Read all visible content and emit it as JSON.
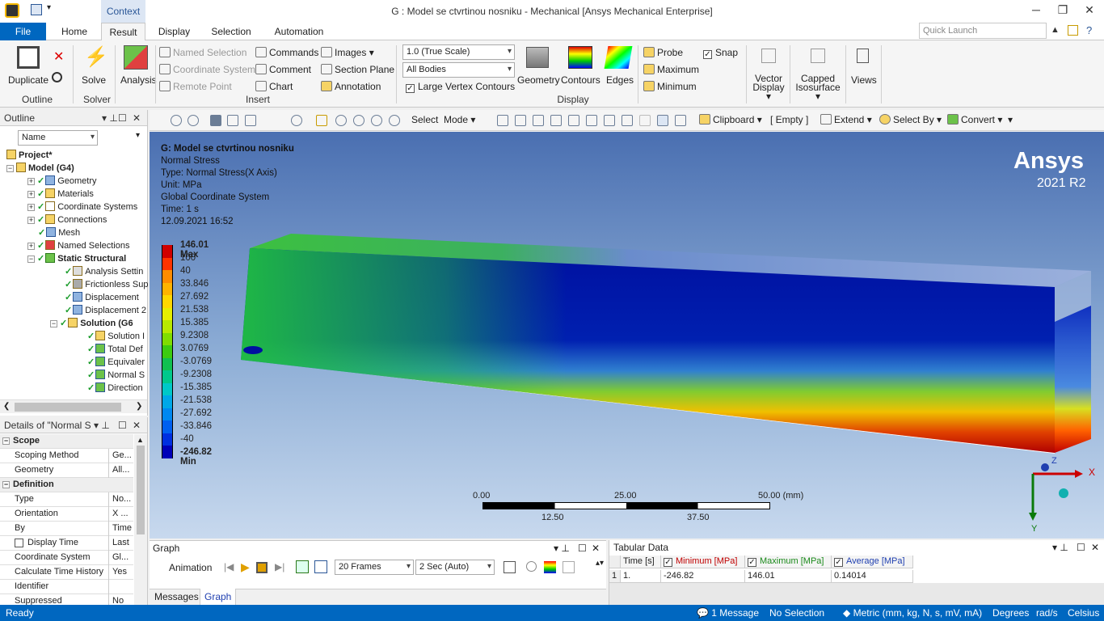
{
  "titlebar": {
    "title": "G : Model se ctvrtinou nosniku - Mechanical [Ansys Mechanical Enterprise]",
    "context_tab": "Context",
    "quick_launch_placeholder": "Quick Launch"
  },
  "tabs": [
    "File",
    "Home",
    "Result",
    "Display",
    "Selection",
    "Automation"
  ],
  "ribbon": {
    "duplicate": "Duplicate",
    "outline_group": "Outline",
    "solve": "Solve",
    "solver_group": "Solver",
    "analysis": "Analysis",
    "named_selection": "Named Selection",
    "coordinate_system": "Coordinate System",
    "remote_point": "Remote Point",
    "commands": "Commands",
    "comment": "Comment",
    "chart": "Chart",
    "images": "Images",
    "section_plane": "Section Plane",
    "annotation": "Annotation",
    "insert_group": "Insert",
    "scale": "1.0 (True Scale)",
    "bodies": "All Bodies",
    "large_vertex": "Large Vertex Contours",
    "geometry": "Geometry",
    "contours": "Contours",
    "edges": "Edges",
    "display_group": "Display",
    "probe": "Probe",
    "maximum": "Maximum",
    "minimum": "Minimum",
    "snap": "Snap",
    "vector_display": "Vector Display",
    "capped_isosurface": "Capped Isosurface",
    "views": "Views"
  },
  "toolbar": {
    "select": "Select",
    "mode": "Mode",
    "clipboard": "Clipboard",
    "empty": "[ Empty ]",
    "extend": "Extend",
    "select_by": "Select By",
    "convert": "Convert"
  },
  "outline": {
    "title": "Outline",
    "filter": "Name",
    "items": [
      "Project*",
      "Model (G4)",
      "Geometry",
      "Materials",
      "Coordinate Systems",
      "Connections",
      "Mesh",
      "Named Selections",
      "Static Structural",
      "Analysis Settin",
      "Frictionless Sup",
      "Displacement",
      "Displacement 2",
      "Solution (G6",
      "Solution I",
      "Total Def",
      "Equivaler",
      "Normal S",
      "Direction"
    ]
  },
  "details": {
    "title": "Details of \"Normal S",
    "rows": [
      {
        "k": "Scope",
        "v": "",
        "sec": true
      },
      {
        "k": "Scoping Method",
        "v": "Ge..."
      },
      {
        "k": "Geometry",
        "v": "All..."
      },
      {
        "k": "Definition",
        "v": "",
        "sec": true
      },
      {
        "k": "Type",
        "v": "No..."
      },
      {
        "k": "Orientation",
        "v": "X ..."
      },
      {
        "k": "By",
        "v": "Time"
      },
      {
        "k": "Display Time",
        "v": "Last"
      },
      {
        "k": "Coordinate System",
        "v": "Gl..."
      },
      {
        "k": "Calculate Time History",
        "v": "Yes"
      },
      {
        "k": "Identifier",
        "v": ""
      },
      {
        "k": "Suppressed",
        "v": "No"
      }
    ]
  },
  "viewport": {
    "lines": [
      "G: Model se ctvrtinou nosniku",
      "Normal Stress",
      "Type: Normal Stress(X Axis)",
      "Unit: MPa",
      "Global Coordinate System",
      "Time: 1 s",
      "12.09.2021 16:52"
    ],
    "legend": [
      "146.01 Max",
      "100",
      "40",
      "33.846",
      "27.692",
      "21.538",
      "15.385",
      "9.2308",
      "3.0769",
      "-3.0769",
      "-9.2308",
      "-15.385",
      "-21.538",
      "-27.692",
      "-33.846",
      "-40",
      "-246.82 Min"
    ],
    "legend_colors": [
      "#d00000",
      "#ff3300",
      "#ff8c00",
      "#ffb300",
      "#ffd700",
      "#e6ee00",
      "#b8e800",
      "#80dd00",
      "#3ccc10",
      "#10c050",
      "#00c88c",
      "#00c8c8",
      "#00a8e8",
      "#0088f0",
      "#0060f0",
      "#0030e0",
      "#0000b8"
    ],
    "brand": "Ansys",
    "version": "2021 R2",
    "scale_labels": [
      "0.00",
      "25.00",
      "50.00 (mm)",
      "12.50",
      "37.50"
    ],
    "axes": {
      "x": "X",
      "y": "Y",
      "z": "Z"
    }
  },
  "graph": {
    "title": "Graph",
    "animation": "Animation",
    "frames": "20 Frames",
    "duration": "2 Sec (Auto)",
    "tab_messages": "Messages",
    "tab_graph": "Graph"
  },
  "tabular": {
    "title": "Tabular Data",
    "headers": [
      "Time [s]",
      "Minimum [MPa]",
      "Maximum [MPa]",
      "Average [MPa]"
    ],
    "row": [
      "1",
      "1.",
      "-246.82",
      "146.01",
      "0.14014"
    ],
    "colors": {
      "min": "#c00000",
      "max": "#1a8a1a",
      "avg": "#1f3fb0"
    }
  },
  "status": {
    "ready": "Ready",
    "messages": "1 Message",
    "selection": "No Selection",
    "units": "Metric (mm, kg, N, s, mV, mA)",
    "angle": "Degrees",
    "rate": "rad/s",
    "temp": "Celsius"
  }
}
